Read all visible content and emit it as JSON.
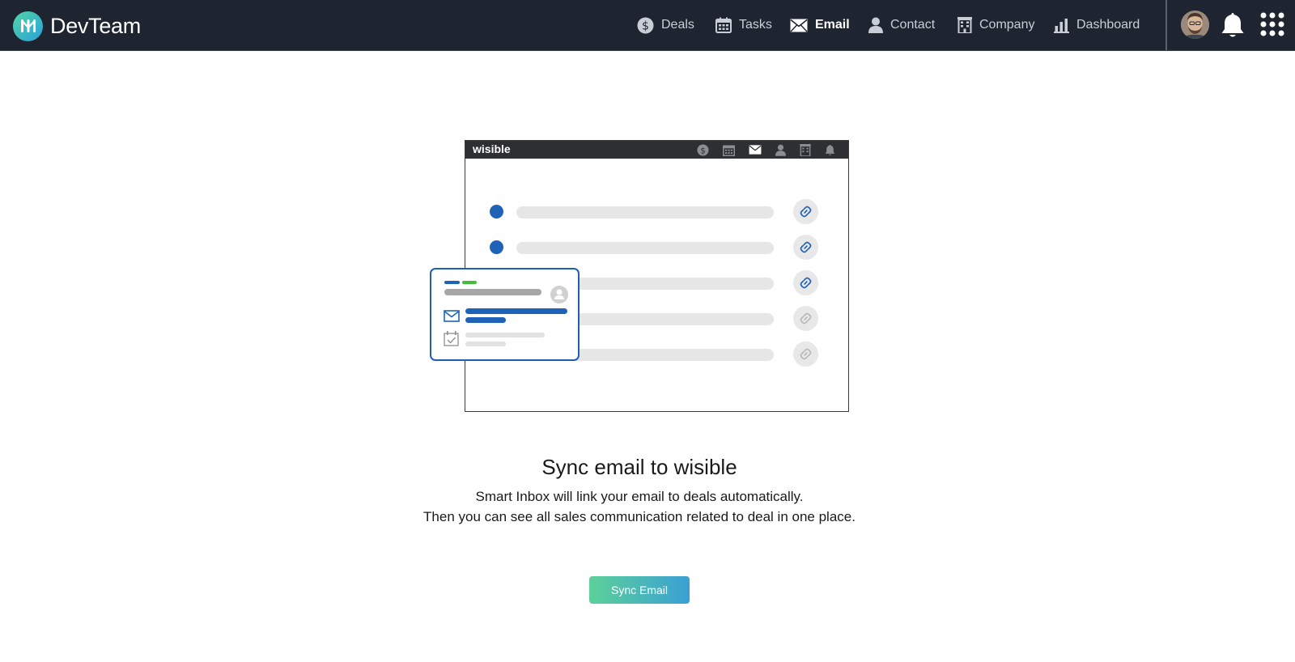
{
  "app": {
    "name": "DevTeam"
  },
  "nav": {
    "items": [
      {
        "label": "Deals",
        "icon": "dollar-icon",
        "active": false
      },
      {
        "label": "Tasks",
        "icon": "calendar-icon",
        "active": false
      },
      {
        "label": "Email",
        "icon": "envelope-icon",
        "active": true
      },
      {
        "label": "Contact",
        "icon": "person-icon",
        "active": false
      },
      {
        "label": "Company",
        "icon": "building-icon",
        "active": false
      },
      {
        "label": "Dashboard",
        "icon": "bar-chart-icon",
        "active": false
      }
    ]
  },
  "illustration": {
    "brand": "wisible",
    "rows": [
      {
        "has_dot": true,
        "link_active": true
      },
      {
        "has_dot": true,
        "link_active": true
      },
      {
        "has_dot": false,
        "link_active": true
      },
      {
        "has_dot": false,
        "link_active": false
      },
      {
        "has_dot": false,
        "link_active": false
      }
    ]
  },
  "main": {
    "title": "Sync email to wisible",
    "subtitle_line1": "Smart Inbox will link your email to deals automatically.",
    "subtitle_line2": "Then you can see all sales communication related to deal in one place.",
    "sync_button": "Sync Email"
  },
  "colors": {
    "topbar": "#1e2530",
    "accent_blue": "#1f63b8",
    "accent_green": "#3fbf3a",
    "button_gradient_start": "#5dd09a",
    "button_gradient_end": "#3aa0d4"
  }
}
